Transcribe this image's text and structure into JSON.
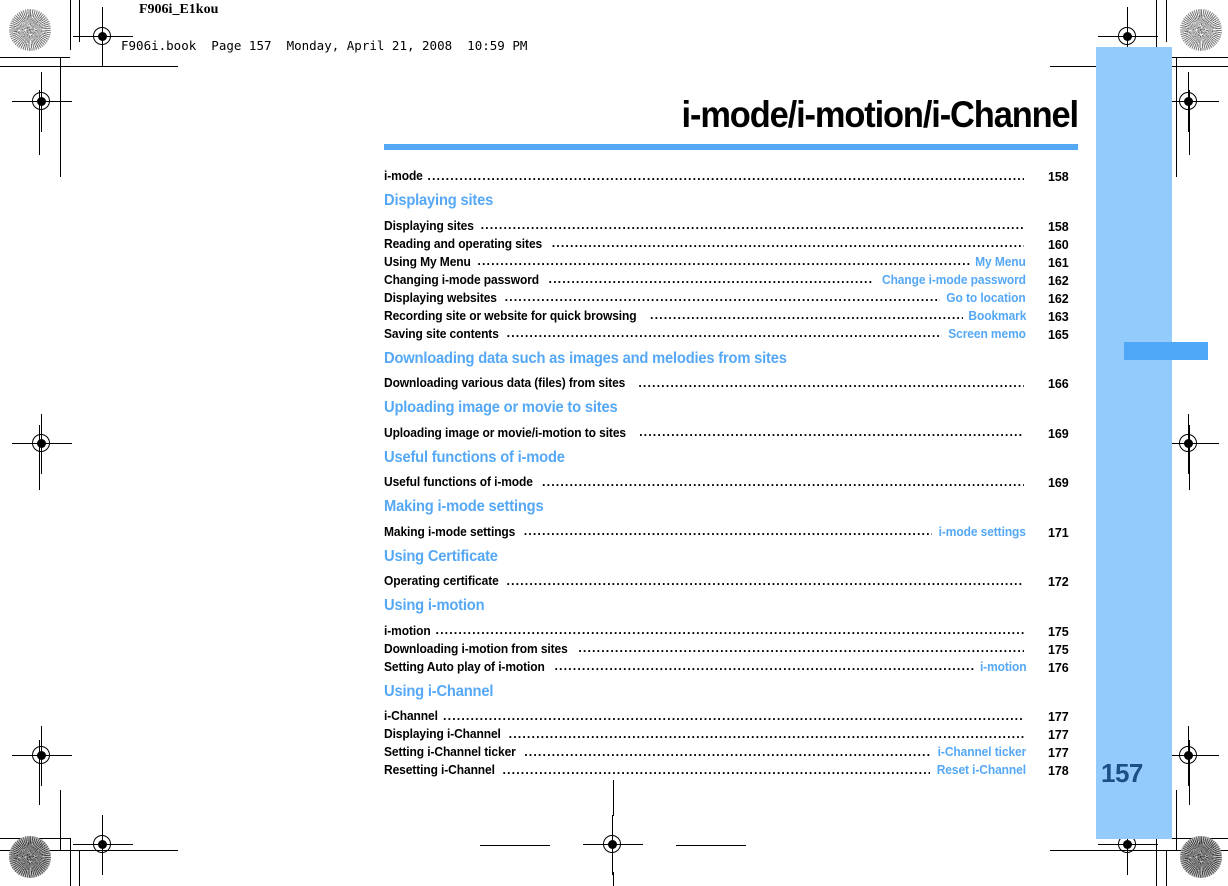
{
  "colors": {
    "accent_blue": "#55a8f5",
    "tab_light_blue": "#93ccfc",
    "tab_marker_blue": "#4fa8f7",
    "page_number_blue": "#1b4f86",
    "text_black": "#000000"
  },
  "header": {
    "doc_id": "F906i_E1kou",
    "book_line": "F906i.book  Page 157  Monday, April 21, 2008  10:59 PM"
  },
  "chapter": {
    "title": "i-mode/i-motion/i-Channel"
  },
  "side_tab": {
    "page_number": "157"
  },
  "toc": [
    {
      "kind": "entry",
      "title": "i-mode",
      "annotation": "",
      "page": "158"
    },
    {
      "kind": "section",
      "title": "Displaying sites"
    },
    {
      "kind": "entry",
      "title": "Displaying sites",
      "annotation": "",
      "page": "158"
    },
    {
      "kind": "entry",
      "title": "Reading and operating sites",
      "annotation": "",
      "page": "160"
    },
    {
      "kind": "entry",
      "title": "Using My Menu",
      "annotation": "My Menu",
      "page": "161"
    },
    {
      "kind": "entry",
      "title": "Changing i-mode password",
      "annotation": "Change i-mode password",
      "page": "162"
    },
    {
      "kind": "entry",
      "title": "Displaying websites",
      "annotation": "Go to location",
      "page": "162"
    },
    {
      "kind": "entry",
      "title": "Recording site or website for quick browsing",
      "annotation": "Bookmark",
      "page": "163"
    },
    {
      "kind": "entry",
      "title": "Saving site contents",
      "annotation": "Screen memo",
      "page": "165"
    },
    {
      "kind": "section",
      "title": "Downloading data such as images and melodies from sites"
    },
    {
      "kind": "entry",
      "title": "Downloading various data (files) from sites",
      "annotation": "",
      "page": "166"
    },
    {
      "kind": "section",
      "title": "Uploading image or movie to sites"
    },
    {
      "kind": "entry",
      "title": "Uploading image or movie/i-motion to sites",
      "annotation": "",
      "page": "169"
    },
    {
      "kind": "section",
      "title": "Useful functions of i-mode"
    },
    {
      "kind": "entry",
      "title": "Useful functions of i-mode",
      "annotation": "",
      "page": "169"
    },
    {
      "kind": "section",
      "title": "Making i-mode settings"
    },
    {
      "kind": "entry",
      "title": "Making i-mode settings",
      "annotation": "i-mode settings",
      "page": "171"
    },
    {
      "kind": "section",
      "title": "Using Certificate"
    },
    {
      "kind": "entry",
      "title": "Operating certificate",
      "annotation": "",
      "page": "172"
    },
    {
      "kind": "section",
      "title": "Using i-motion"
    },
    {
      "kind": "entry",
      "title": "i-motion",
      "annotation": "",
      "page": "175"
    },
    {
      "kind": "entry",
      "title": "Downloading i-motion from sites",
      "annotation": "",
      "page": "175"
    },
    {
      "kind": "entry",
      "title": "Setting Auto play of i-motion",
      "annotation": "i-motion",
      "page": "176"
    },
    {
      "kind": "section",
      "title": "Using i-Channel"
    },
    {
      "kind": "entry",
      "title": "i-Channel",
      "annotation": "",
      "page": "177"
    },
    {
      "kind": "entry",
      "title": "Displaying i-Channel",
      "annotation": "",
      "page": "177"
    },
    {
      "kind": "entry",
      "title": "Setting i-Channel ticker",
      "annotation": "i-Channel ticker",
      "page": "177"
    },
    {
      "kind": "entry",
      "title": "Resetting i-Channel",
      "annotation": "Reset i-Channel",
      "page": "178"
    }
  ]
}
